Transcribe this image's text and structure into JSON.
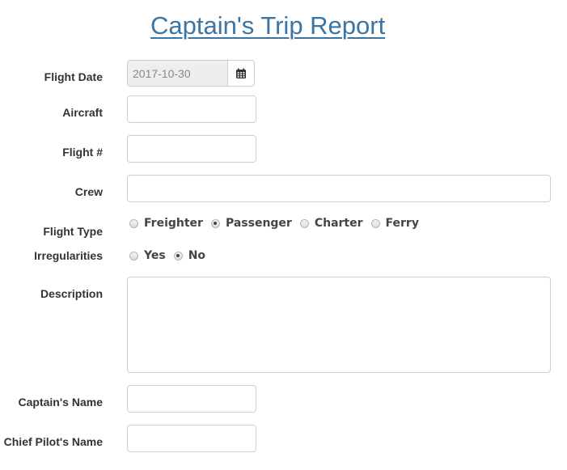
{
  "title": "Captain's Trip Report",
  "fields": {
    "flight_date": {
      "label": "Flight Date",
      "value": "2017-10-30",
      "icon": "calendar-icon"
    },
    "aircraft": {
      "label": "Aircraft",
      "value": ""
    },
    "flight_number": {
      "label": "Flight #",
      "value": ""
    },
    "crew": {
      "label": "Crew",
      "value": ""
    },
    "flight_type": {
      "label": "Flight Type",
      "options": [
        "Freighter",
        "Passenger",
        "Charter",
        "Ferry"
      ],
      "selected": "Passenger"
    },
    "irregularities": {
      "label": "Irregularities",
      "options": [
        "Yes",
        "No"
      ],
      "selected": "No"
    },
    "description": {
      "label": "Description",
      "value": ""
    },
    "captains_name": {
      "label": "Captain's Name",
      "value": ""
    },
    "chief_pilots_name": {
      "label": "Chief Pilot's Name",
      "value": ""
    }
  },
  "colors": {
    "title": "#3a75a6",
    "disabled_bg": "#eeeeee",
    "border": "#cfcfcf"
  }
}
